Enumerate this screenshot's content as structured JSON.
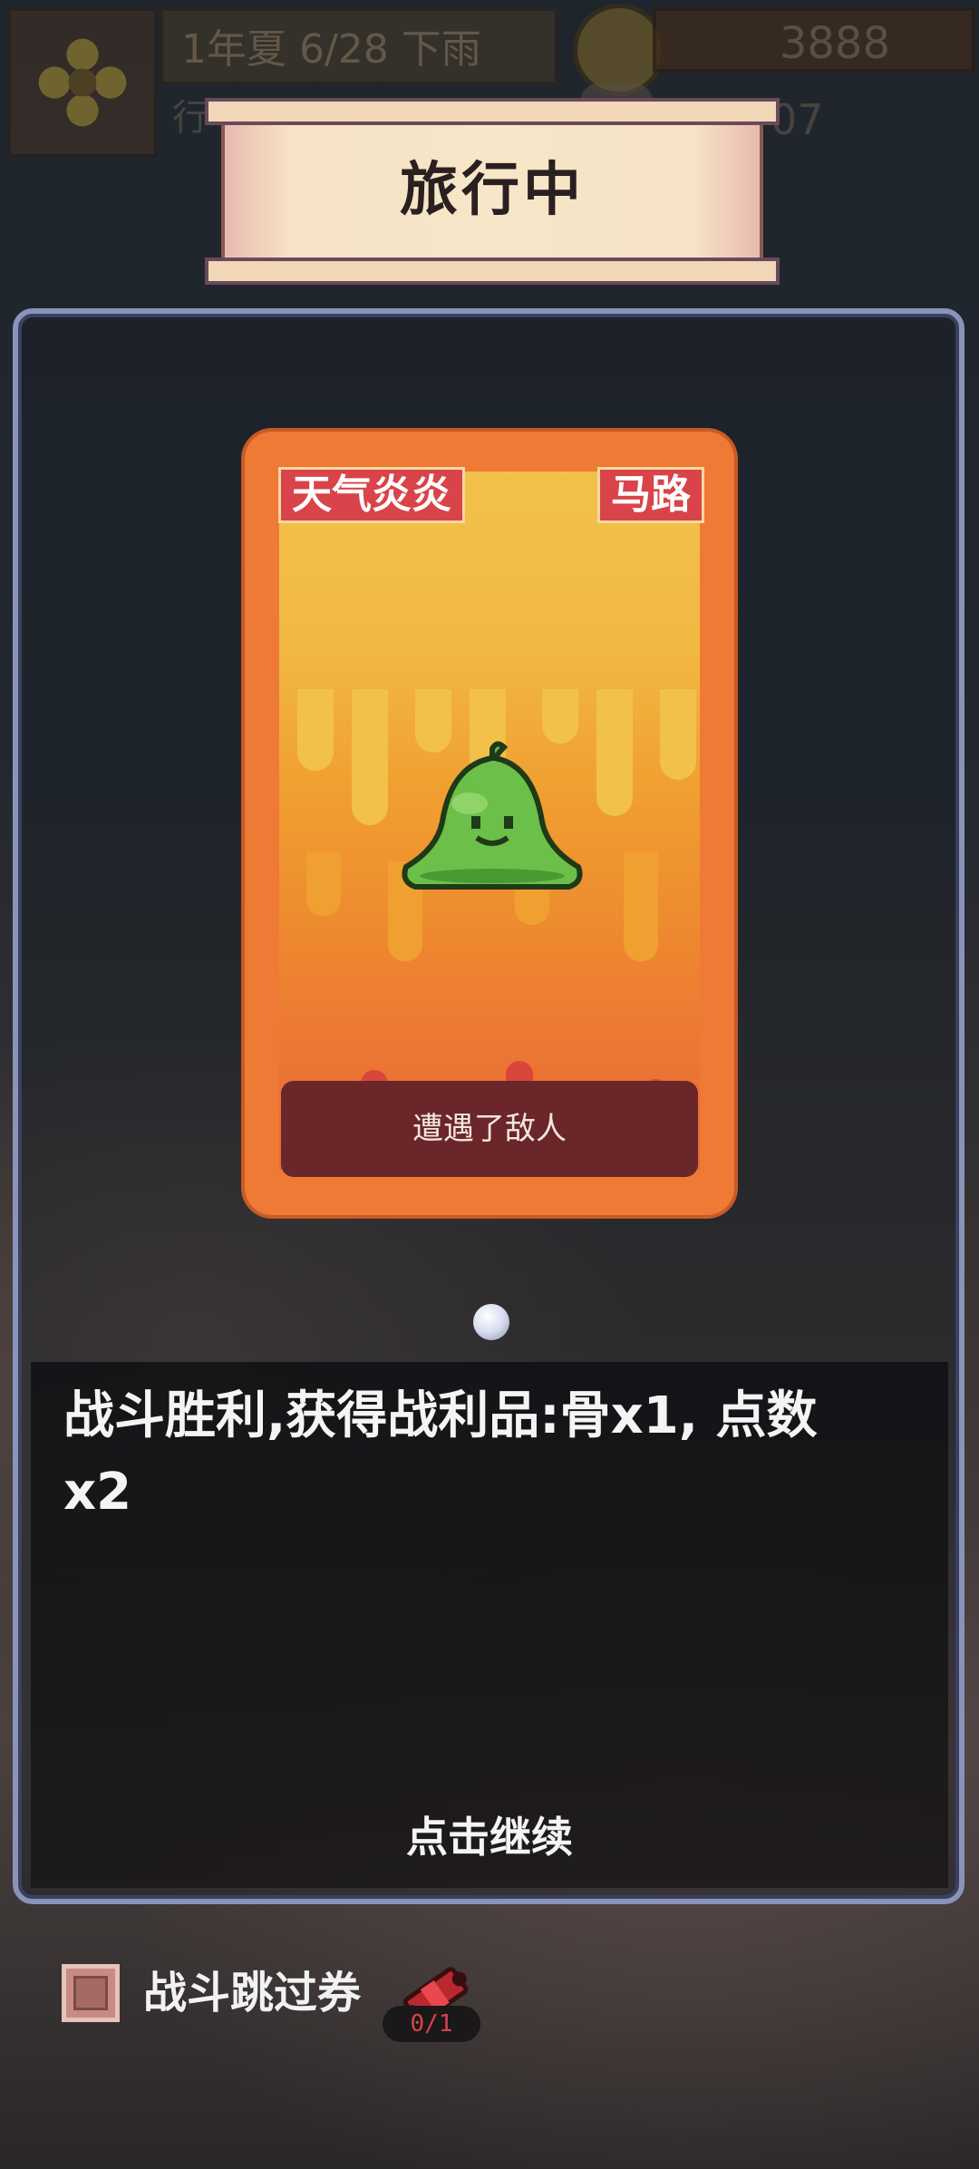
{
  "hud": {
    "date": "1年夏 6/28 下雨",
    "subtitle": "行",
    "money": "3888",
    "second_value": "07"
  },
  "title": "旅行中",
  "card": {
    "weather_tag": "天气炎炎",
    "location_tag": "马路",
    "event": "遭遇了敌人",
    "creature_icon": "green-slime-icon"
  },
  "dialog": {
    "message": "战斗胜利,获得战利品:骨x1, 点数x2",
    "continue_label": "点击继续"
  },
  "skip": {
    "label": "战斗跳过券",
    "count": "0/1",
    "checked": false
  },
  "colors": {
    "card_orange": "#ee7a36",
    "tag_red": "#d9434a",
    "panel_border": "#8a93b8"
  }
}
